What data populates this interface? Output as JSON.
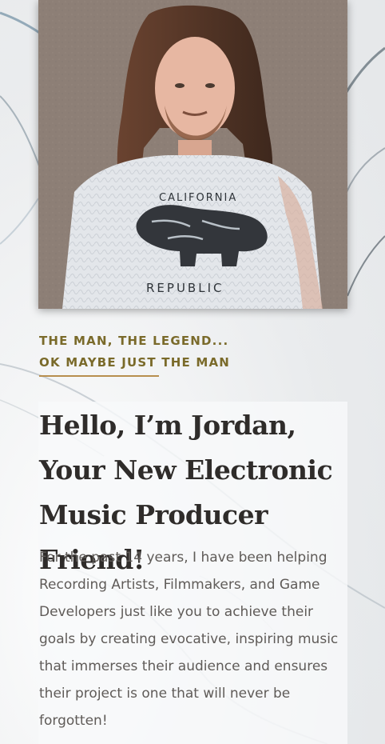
{
  "hero": {
    "photo_alt": "Jordan portrait",
    "shirt_text_top": "CALIFORNIA",
    "shirt_text_bottom": "REPUBLIC"
  },
  "about": {
    "eyebrow_line_1": "THE MAN, THE LEGEND...",
    "eyebrow_line_2": "OK MAYBE JUST THE MAN",
    "headline": "Hello, I’m Jordan, Your New Electronic Music Producer Friend!",
    "intro": "For the past 14 years, I have been helping Recording Artists, Filmmakers, and Game Developers just like you to achieve their goals by creating evocative, inspiring music that immerses their audience and ensures their project is one that will never be forgotten!"
  },
  "colors": {
    "eyebrow": "#7a6a2a",
    "divider": "#b88f4f",
    "headline": "#2f2c2a",
    "body_text": "#5f5b58"
  }
}
